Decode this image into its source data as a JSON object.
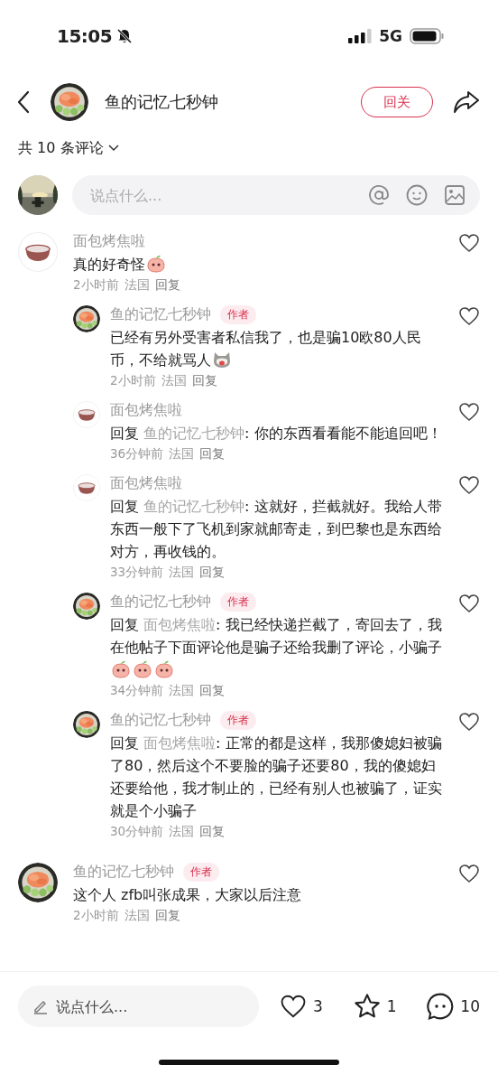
{
  "status_bar": {
    "time": "15:05",
    "network": "5G"
  },
  "header": {
    "avatar": {
      "kind": "sushi"
    },
    "title": "鱼的记忆七秒钟",
    "follow_button": "回关"
  },
  "comment_count": "共 10 条评论",
  "comment_input": {
    "avatar": {
      "kind": "scenery"
    },
    "placeholder": "说点什么..."
  },
  "comments": [
    {
      "avatar": {
        "kind": "bowl"
      },
      "name": "面包烤焦啦",
      "text": "真的好奇怪",
      "emojis": [
        {
          "kind": "peach"
        }
      ],
      "time": "2小时前",
      "location": "法国",
      "reply": "回复",
      "liked": false,
      "children": [
        {
          "avatar": {
            "kind": "sushi"
          },
          "name": "鱼的记忆七秒钟",
          "badge": "作者",
          "text": "已经有另外受害者私信我了，也是骗10欧80人民币，不给就骂人",
          "emojis": [
            {
              "kind": "cat"
            }
          ],
          "time": "2小时前",
          "location": "法国",
          "reply": "回复",
          "liked": false
        },
        {
          "avatar": {
            "kind": "bowl"
          },
          "name": "面包烤焦啦",
          "reply_prefix": "回复",
          "reply_to": "鱼的记忆七秒钟",
          "text": ": 你的东西看看能不能追回吧！",
          "time": "36分钟前",
          "location": "法国",
          "reply": "回复",
          "liked": false
        },
        {
          "avatar": {
            "kind": "bowl"
          },
          "name": "面包烤焦啦",
          "reply_prefix": "回复",
          "reply_to": "鱼的记忆七秒钟",
          "text": ": 这就好，拦截就好。我给人带东西一般下了飞机到家就邮寄走，到巴黎也是东西给对方，再收钱的。",
          "time": "33分钟前",
          "location": "法国",
          "reply": "回复",
          "liked": false
        },
        {
          "avatar": {
            "kind": "sushi"
          },
          "name": "鱼的记忆七秒钟",
          "badge": "作者",
          "reply_prefix": "回复",
          "reply_to": "面包烤焦啦",
          "text": ": 我已经快递拦截了，寄回去了，我在他帖子下面评论他是骗子还给我删了评论，小骗子",
          "emojis": [
            {
              "kind": "peach"
            },
            {
              "kind": "peach"
            },
            {
              "kind": "peach"
            }
          ],
          "time": "34分钟前",
          "location": "法国",
          "reply": "回复",
          "liked": false
        },
        {
          "avatar": {
            "kind": "sushi"
          },
          "name": "鱼的记忆七秒钟",
          "badge": "作者",
          "reply_prefix": "回复",
          "reply_to": "面包烤焦啦",
          "text": ": 正常的都是这样，我那傻媳妇被骗了80，然后这个不要脸的骗子还要80，我的傻媳妇还要给他，我才制止的，已经有别人也被骗了，证实就是个小骗子",
          "time": "30分钟前",
          "location": "法国",
          "reply": "回复",
          "liked": false
        }
      ]
    },
    {
      "avatar": {
        "kind": "sushi"
      },
      "name": "鱼的记忆七秒钟",
      "badge": "作者",
      "text": "这个人 zfb叫张成果，大家以后注意",
      "time": "2小时前",
      "location": "法国",
      "reply": "回复",
      "liked": false
    }
  ],
  "bottom_bar": {
    "placeholder": "说点什么...",
    "likes": "3",
    "favorites": "1",
    "comment_total": "10"
  }
}
